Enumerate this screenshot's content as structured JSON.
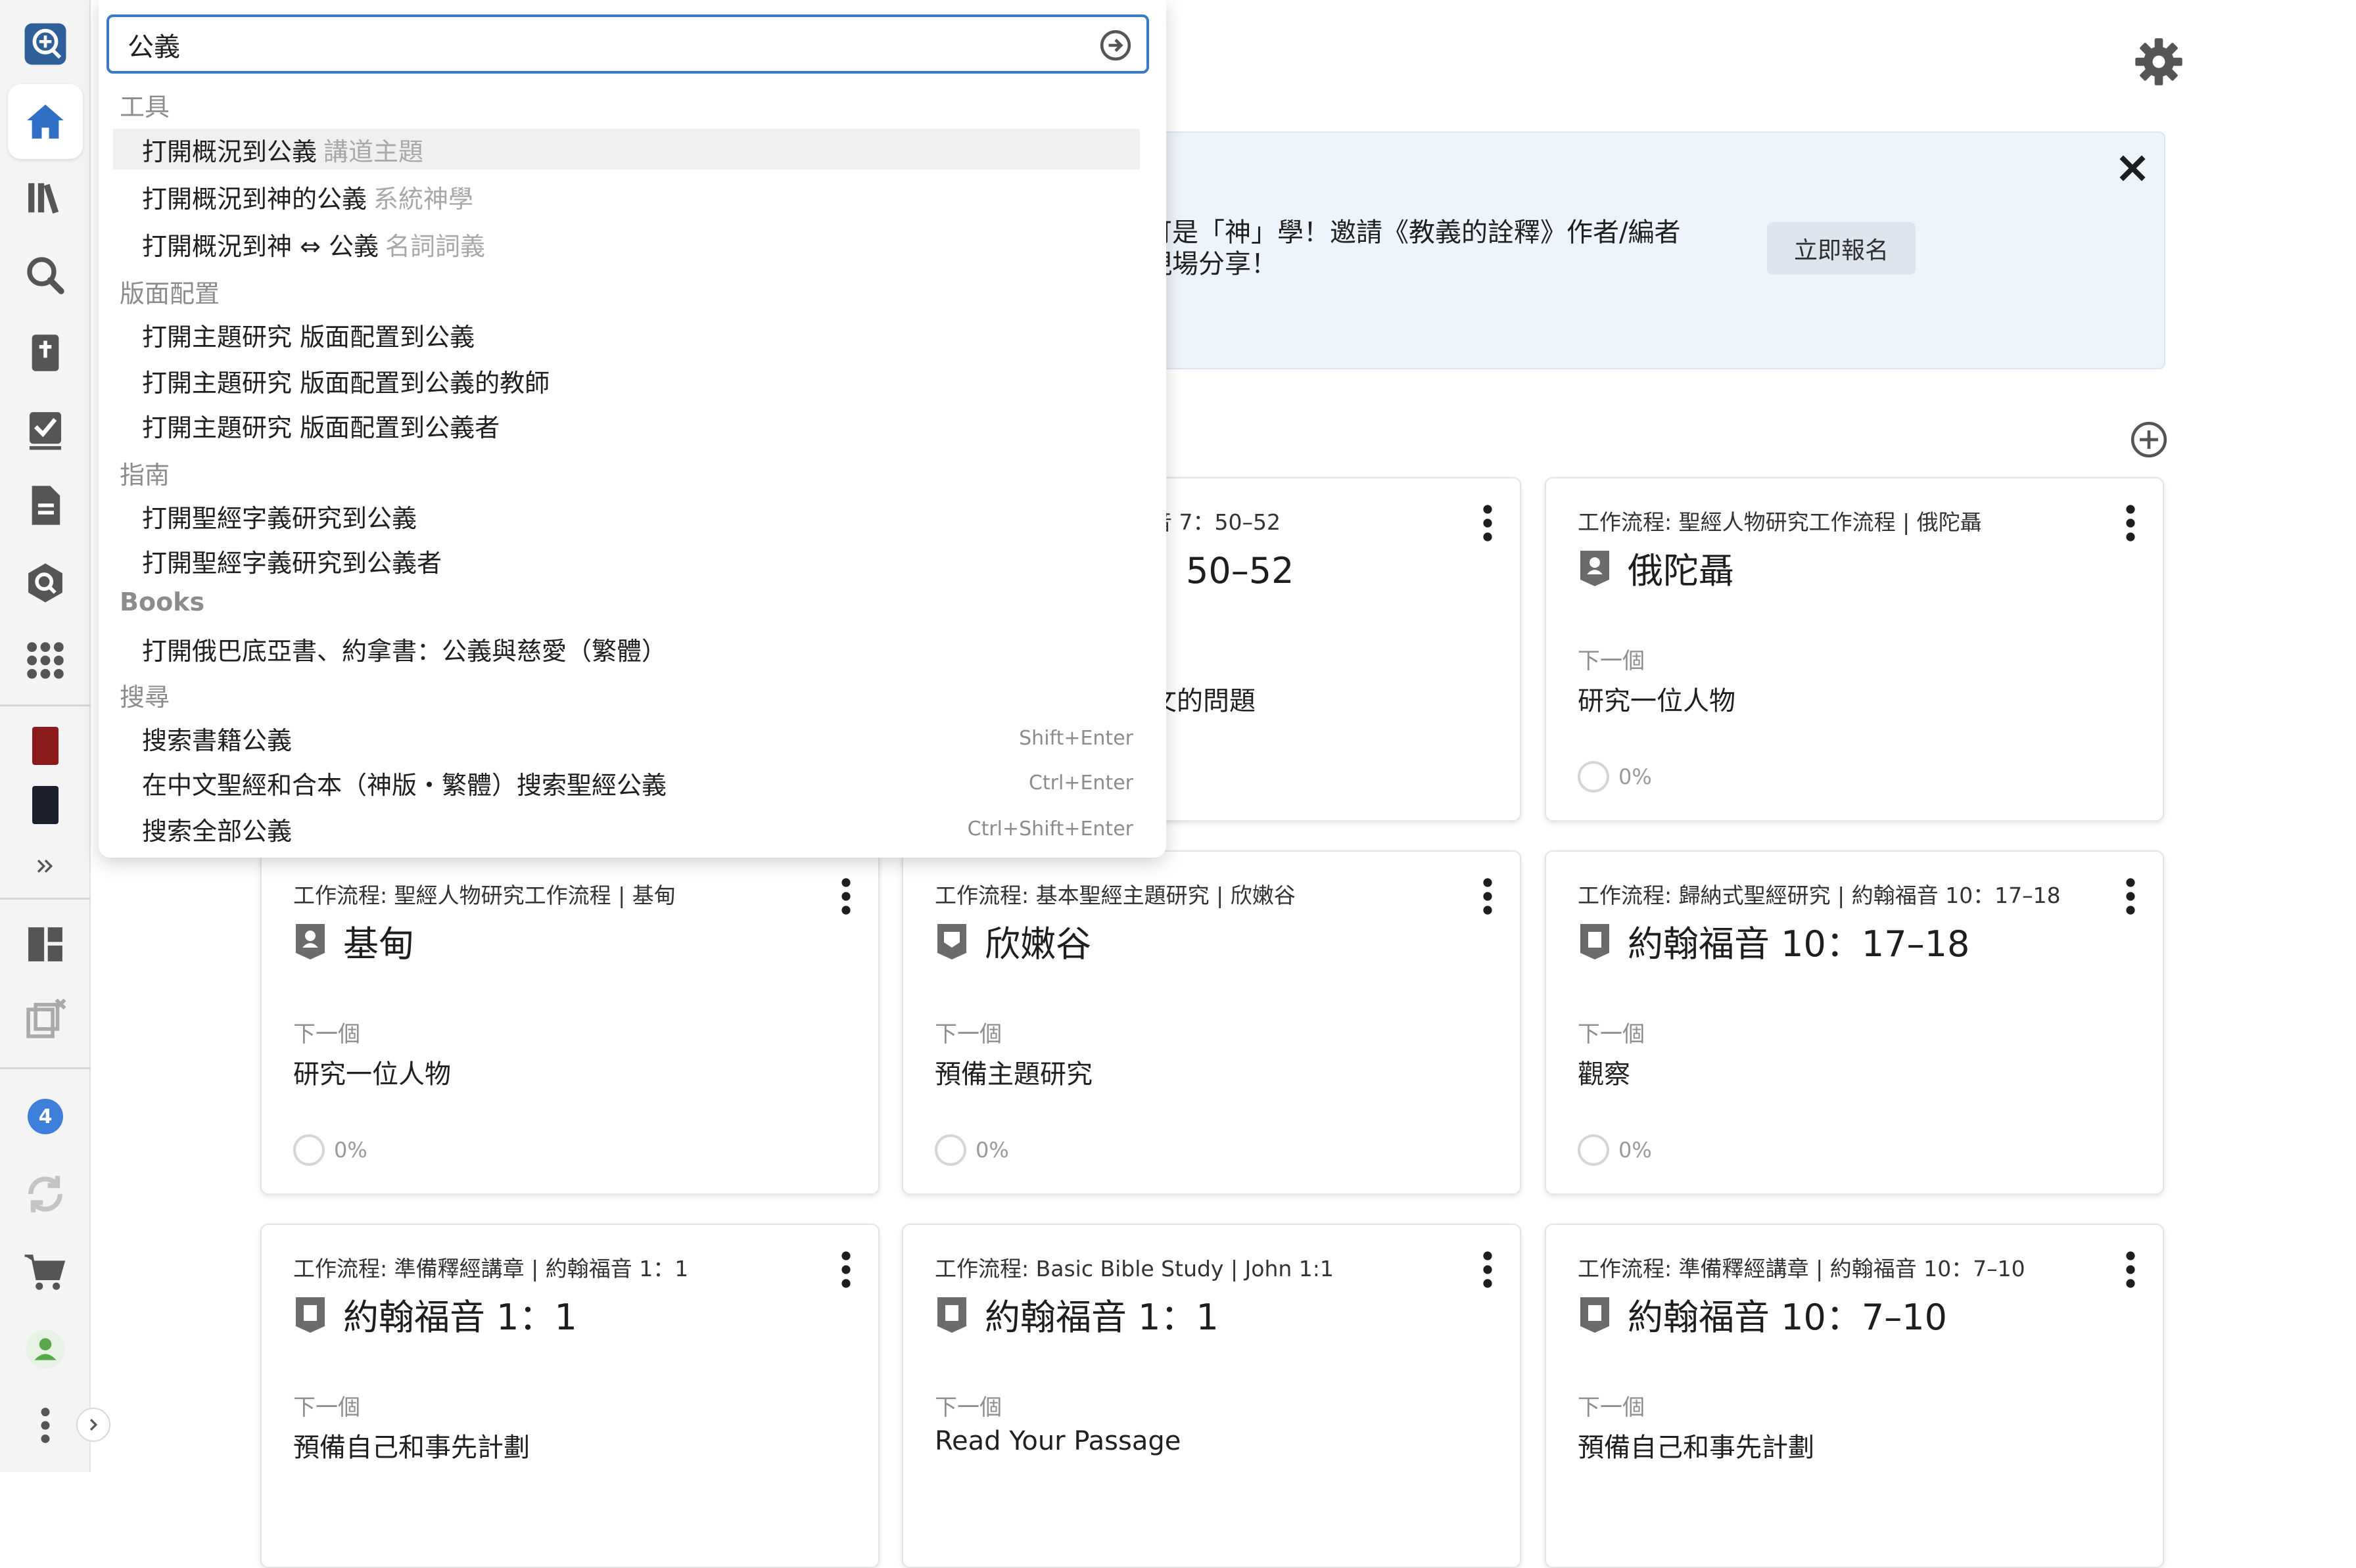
{
  "header": {
    "gear_icon": "gear-icon"
  },
  "banner": {
    "line1": "可是「神」學！邀請《教義的詮釋》作者/編者",
    "line2": "現場分享！",
    "button_label": "立即報名"
  },
  "sidebar": {
    "badge_count": "4"
  },
  "cards": [
    {
      "subtitle": "音 7：50–52",
      "title": "：50–52",
      "next_label": "",
      "next": "文的問題",
      "progress": ""
    },
    {
      "subtitle": "工作流程: 聖經人物研究工作流程 | 俄陀聶",
      "title": "俄陀聶",
      "next_label": "下一個",
      "next": "研究一位人物",
      "progress": "0%"
    },
    {
      "subtitle": "工作流程: 聖經人物研究工作流程 | 基甸",
      "title": "基甸",
      "next_label": "下一個",
      "next": "研究一位人物",
      "progress": "0%"
    },
    {
      "subtitle": "工作流程: 基本聖經主題研究 | 欣嫩谷",
      "title": "欣嫩谷",
      "next_label": "下一個",
      "next": "預備主題研究",
      "progress": "0%"
    },
    {
      "subtitle": "工作流程: 歸納式聖經研究 | 約翰福音 10：17–18",
      "title": "約翰福音 10：17–18",
      "next_label": "下一個",
      "next": "觀察",
      "progress": "0%"
    },
    {
      "subtitle": "工作流程: 準備釋經講章 | 約翰福音 1：1",
      "title": "約翰福音 1：1",
      "next_label": "下一個",
      "next": "預備自己和事先計劃",
      "progress": ""
    },
    {
      "subtitle": "工作流程: Basic Bible Study | John 1:1",
      "title": "約翰福音 1：1",
      "next_label": "下一個",
      "next": "Read Your Passage",
      "progress": ""
    },
    {
      "subtitle": "工作流程: 準備釋經講章 | 約翰福音 10：7–10",
      "title": "約翰福音 10：7–10",
      "next_label": "下一個",
      "next": "預備自己和事先計劃",
      "progress": ""
    }
  ],
  "search": {
    "value": "公義",
    "sections": {
      "tools": "工具",
      "layouts": "版面配置",
      "guides": "指南",
      "books": "Books",
      "search": "搜尋"
    },
    "tools": [
      {
        "label": "打開概況到公義",
        "hint": "講道主題"
      },
      {
        "label": "打開概況到神的公義",
        "hint": "系統神學"
      },
      {
        "label": "打開概況到神 ⇔ 公義",
        "hint": "名詞詞義"
      }
    ],
    "layouts": [
      {
        "label": "打開主題研究 版面配置到公義"
      },
      {
        "label": "打開主題研究 版面配置到公義的教師"
      },
      {
        "label": "打開主題研究 版面配置到公義者"
      }
    ],
    "guides": [
      {
        "label": "打開聖經字義研究到公義"
      },
      {
        "label": "打開聖經字義研究到公義者"
      }
    ],
    "books": [
      {
        "label": "打開俄巴底亞書、約拿書：公義與慈愛（繁體）"
      }
    ],
    "searches": [
      {
        "label": "搜索書籍公義",
        "shortcut": "Shift+Enter"
      },
      {
        "label": "在中文聖經和合本（神版・繁體）搜索聖經公義",
        "shortcut": "Ctrl+Enter"
      },
      {
        "label": "搜索全部公義",
        "shortcut": "Ctrl+Shift+Enter"
      }
    ]
  }
}
